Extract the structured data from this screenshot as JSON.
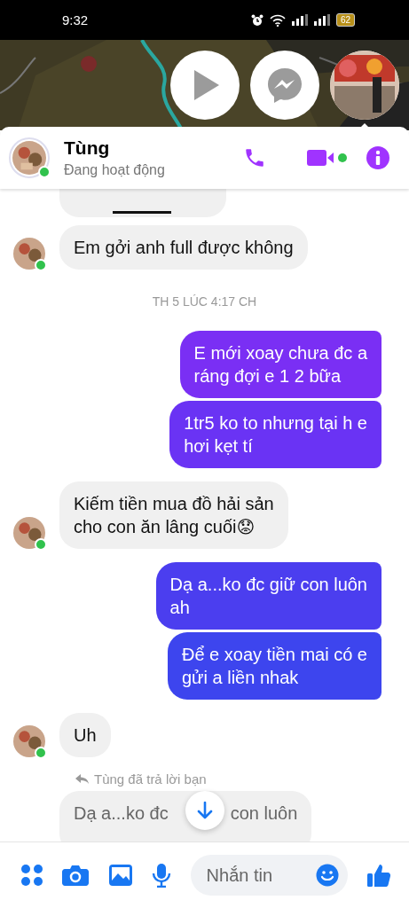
{
  "status_bar": {
    "time": "9:32",
    "battery": "62"
  },
  "chat_heads": [
    {
      "kind": "play"
    },
    {
      "kind": "messenger"
    },
    {
      "kind": "avatar"
    }
  ],
  "header": {
    "name": "Tùng",
    "status": "Đang hoạt động",
    "online": true
  },
  "messages": [
    {
      "kind": "cut"
    },
    {
      "kind": "received",
      "lines": [
        "Em gởi anh full được không"
      ],
      "avatar": true
    },
    {
      "kind": "time",
      "text": "TH 5 LÚC 4:17 CH"
    },
    {
      "kind": "sent",
      "lines": [
        "E mới xoay chưa đc a",
        "ráng đợi e 1 2 bữa"
      ],
      "color": "#7a2ff4"
    },
    {
      "kind": "sent",
      "lines": [
        "1tr5 ko to nhưng tại h e",
        "hơi kẹt tí"
      ],
      "color": "#6a33f4"
    },
    {
      "kind": "received",
      "lines": [
        "Kiếm tiền mua đồ hải sản",
        "cho con ăn lâng cuối😟"
      ],
      "avatar": true
    },
    {
      "kind": "sent",
      "lines": [
        "Dạ a...ko đc giữ con luôn",
        "ah"
      ],
      "color": "#4b3eef"
    },
    {
      "kind": "sent",
      "lines": [
        "Để e xoay tiền mai có e",
        "gửi a liền nhak"
      ],
      "color": "#3d45ee"
    },
    {
      "kind": "received",
      "lines": [
        "Uh"
      ],
      "avatar": true
    },
    {
      "kind": "reply_note",
      "text": "Tùng đã trả lời bạn"
    },
    {
      "kind": "quoted",
      "parts": [
        "Dạ a...ko đc",
        "con luôn"
      ]
    }
  ],
  "composer": {
    "placeholder": "Nhắn tin"
  }
}
